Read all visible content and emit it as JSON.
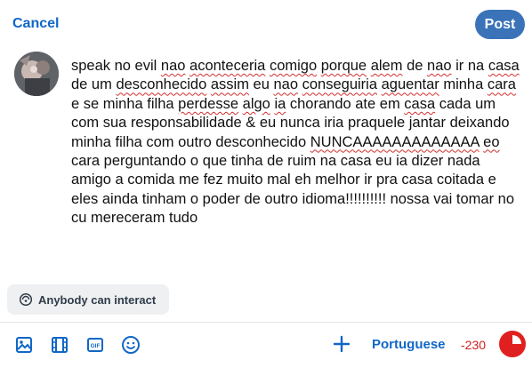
{
  "header": {
    "cancel_label": "Cancel",
    "post_label": "Post"
  },
  "composer": {
    "avatar_icon": "profile-photo",
    "text_segments": [
      {
        "t": "speak no evil ",
        "sp": false
      },
      {
        "t": "nao",
        "sp": true
      },
      {
        "t": " ",
        "sp": false
      },
      {
        "t": "aconteceria",
        "sp": true
      },
      {
        "t": " ",
        "sp": false
      },
      {
        "t": "comigo",
        "sp": true
      },
      {
        "t": " ",
        "sp": false
      },
      {
        "t": "porque",
        "sp": true
      },
      {
        "t": " ",
        "sp": false
      },
      {
        "t": "alem",
        "sp": true
      },
      {
        "t": " de ",
        "sp": false
      },
      {
        "t": "nao",
        "sp": true
      },
      {
        "t": " ir na ",
        "sp": false
      },
      {
        "t": "casa",
        "sp": true
      },
      {
        "t": " de um ",
        "sp": false
      },
      {
        "t": "desconhecido",
        "sp": true
      },
      {
        "t": " ",
        "sp": false
      },
      {
        "t": "assim",
        "sp": true
      },
      {
        "t": " eu ",
        "sp": false
      },
      {
        "t": "nao",
        "sp": true
      },
      {
        "t": " ",
        "sp": false
      },
      {
        "t": "conseguiria",
        "sp": true
      },
      {
        "t": " ",
        "sp": false
      },
      {
        "t": "aguentar",
        "sp": true
      },
      {
        "t": " minha ",
        "sp": false
      },
      {
        "t": "cara",
        "sp": true
      },
      {
        "t": " e se minha filha ",
        "sp": false
      },
      {
        "t": "perdesse",
        "sp": true
      },
      {
        "t": " ",
        "sp": false
      },
      {
        "t": "algo",
        "sp": true
      },
      {
        "t": " ",
        "sp": false
      },
      {
        "t": "ia",
        "sp": true
      },
      {
        "t": " chorando ate em ",
        "sp": false
      },
      {
        "t": "casa",
        "sp": true
      },
      {
        "t": " cada um com sua responsabilidade & eu nunca iria praquele jantar deixando minha filha com outro desconhecido ",
        "sp": false
      },
      {
        "t": "NUNCAAAAAAAAAAAAA",
        "sp": true
      },
      {
        "t": " ",
        "sp": false
      },
      {
        "t": "eo",
        "sp": true
      },
      {
        "t": " cara perguntando o que tinha de ruim na casa eu ia dizer nada amigo a comida me fez muito mal eh melhor ir pra casa coitada e eles ainda tinham o poder de outro idioma!!!!!!!!!! nossa vai tomar no cu mereceram tudo",
        "sp": false
      }
    ]
  },
  "interaction": {
    "label": "Anybody can interact",
    "icon": "globe-settings-icon"
  },
  "toolbar": {
    "icons": [
      "image-icon",
      "video-icon",
      "gif-icon",
      "emoji-icon",
      "plus-icon"
    ],
    "gif_text": "GIF",
    "language": "Portuguese",
    "char_count": "-230",
    "counter_color": "#e02020"
  },
  "colors": {
    "accent": "#1167c6",
    "post_button": "#3a73b8",
    "error": "#d42020"
  }
}
